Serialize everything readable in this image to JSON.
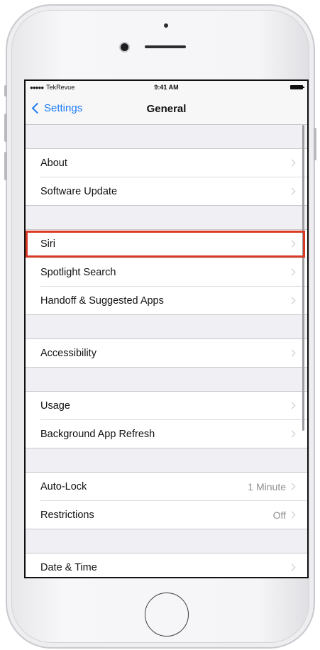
{
  "status_bar": {
    "carrier": "TekRevue",
    "signal_dots": "●●●●●",
    "time": "9:41 AM"
  },
  "nav": {
    "back_label": "Settings",
    "title": "General"
  },
  "groups": [
    {
      "rows": [
        {
          "label": "About",
          "value": ""
        },
        {
          "label": "Software Update",
          "value": ""
        }
      ]
    },
    {
      "rows": [
        {
          "label": "Siri",
          "value": "",
          "highlighted": true
        },
        {
          "label": "Spotlight Search",
          "value": ""
        },
        {
          "label": "Handoff & Suggested Apps",
          "value": ""
        }
      ]
    },
    {
      "rows": [
        {
          "label": "Accessibility",
          "value": ""
        }
      ]
    },
    {
      "rows": [
        {
          "label": "Usage",
          "value": ""
        },
        {
          "label": "Background App Refresh",
          "value": ""
        }
      ]
    },
    {
      "rows": [
        {
          "label": "Auto-Lock",
          "value": "1 Minute"
        },
        {
          "label": "Restrictions",
          "value": "Off"
        }
      ]
    },
    {
      "rows": [
        {
          "label": "Date & Time",
          "value": ""
        }
      ]
    }
  ],
  "colors": {
    "accent": "#1b7bf5",
    "highlight_box": "#d93a26",
    "grouped_background": "#efeff4"
  },
  "icons": {
    "back": "chevron-left-icon",
    "row_disclosure": "chevron-right-icon"
  }
}
